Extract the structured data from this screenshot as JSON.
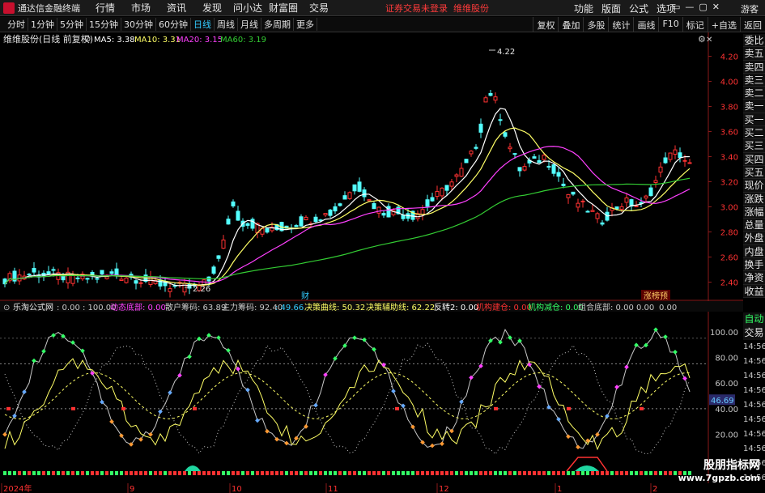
{
  "titlebar": {
    "app_title": "通达信金融终端",
    "menu": [
      "行情",
      "市场",
      "资讯",
      "发现",
      "问小达",
      "财富圈",
      "交易"
    ],
    "login_msg": "证券交易未登录",
    "stock_name_tab": "维维股份",
    "right_menu": [
      "功能",
      "版面",
      "公式",
      "选项"
    ],
    "guest": "游客",
    "ctrl": [
      "▭",
      "—",
      "▢",
      "✕"
    ]
  },
  "toolbar": {
    "periods": [
      "分时",
      "1分钟",
      "5分钟",
      "15分钟",
      "30分钟",
      "60分钟",
      "日线",
      "周线",
      "月线",
      "多周期",
      "更多"
    ],
    "active_period": "日线",
    "tools": [
      "复权",
      "叠加",
      "多股",
      "统计",
      "画线",
      "F10",
      "标记",
      "+自选",
      "返回"
    ]
  },
  "kline": {
    "title": "维维股份(日线 前复权)",
    "ma5": "MA5: 3.38",
    "ma10": "MA10: 3.31",
    "ma20": "MA20: 3.15",
    "ma60": "MA60: 3.19",
    "high_label": "4.22",
    "low_label": "2.26",
    "cai_label": "财",
    "zhang_label": "涨榜预",
    "ticks": [
      "4.20",
      "4.00",
      "3.80",
      "3.60",
      "3.40",
      "3.20",
      "3.00",
      "2.80",
      "2.60",
      "2.40"
    ],
    "colors": {
      "up": "#ff3232",
      "down": "#54ffff",
      "ma5": "#ffffff",
      "ma10": "#ffff66",
      "ma20": "#ff40ff",
      "ma60": "#33cc33"
    }
  },
  "side_quote": [
    "委比",
    "卖五",
    "卖四",
    "卖三",
    "卖二",
    "卖一",
    "买一",
    "买二",
    "买三",
    "买四",
    "买五",
    "现价",
    "涨跌",
    "涨幅",
    "总量",
    "外盘",
    "内盘",
    "换手",
    "净资",
    "收益"
  ],
  "indicator": {
    "name": "乐淘公式网",
    "range": ": 0.00 : 100.00",
    "items": [
      {
        "label": "动态底部: 0.00",
        "color": "#ff40ff"
      },
      {
        "label": "散户筹码: 63.89",
        "color": "#c8c8c8"
      },
      {
        "label": "主力筹码: 92.40",
        "color": "#c8c8c8"
      },
      {
        "label": ": 49.66",
        "color": "#33ccff"
      },
      {
        "label": "决策曲线: 50.32",
        "color": "#ffff66"
      },
      {
        "label": "决策辅助线: 62.22",
        "color": "#ffff66"
      },
      {
        "label": "反转2: 0.00",
        "color": "#ffffff"
      },
      {
        "label": "机构建仓: 0.00",
        "color": "#ff3232"
      },
      {
        "label": "机构减仓: 0.00",
        "color": "#33ff66"
      },
      {
        "label": "组合底部: 0.00",
        "color": "#c8c8c8"
      },
      {
        "label": "0.00",
        "color": "#c8c8c8"
      },
      {
        "label": "0.00",
        "color": "#c8c8c8"
      }
    ],
    "ticks": [
      "100.00",
      "80.00",
      "60.00",
      "40.00",
      "20.00"
    ],
    "current_value": "46.69"
  },
  "side_lower": [
    "自动",
    "交易"
  ],
  "time_rows": [
    "14:56",
    "14:56",
    "14:56",
    "14:56",
    "14:56",
    "14:56",
    "14:56",
    "14:56",
    "14:56",
    "14:56"
  ],
  "dates": [
    "2024年",
    "9",
    "10",
    "11",
    "12",
    "1",
    "2"
  ],
  "watermark": {
    "line1": "股朋指标网",
    "line2": "www.7gpzb.com"
  }
}
